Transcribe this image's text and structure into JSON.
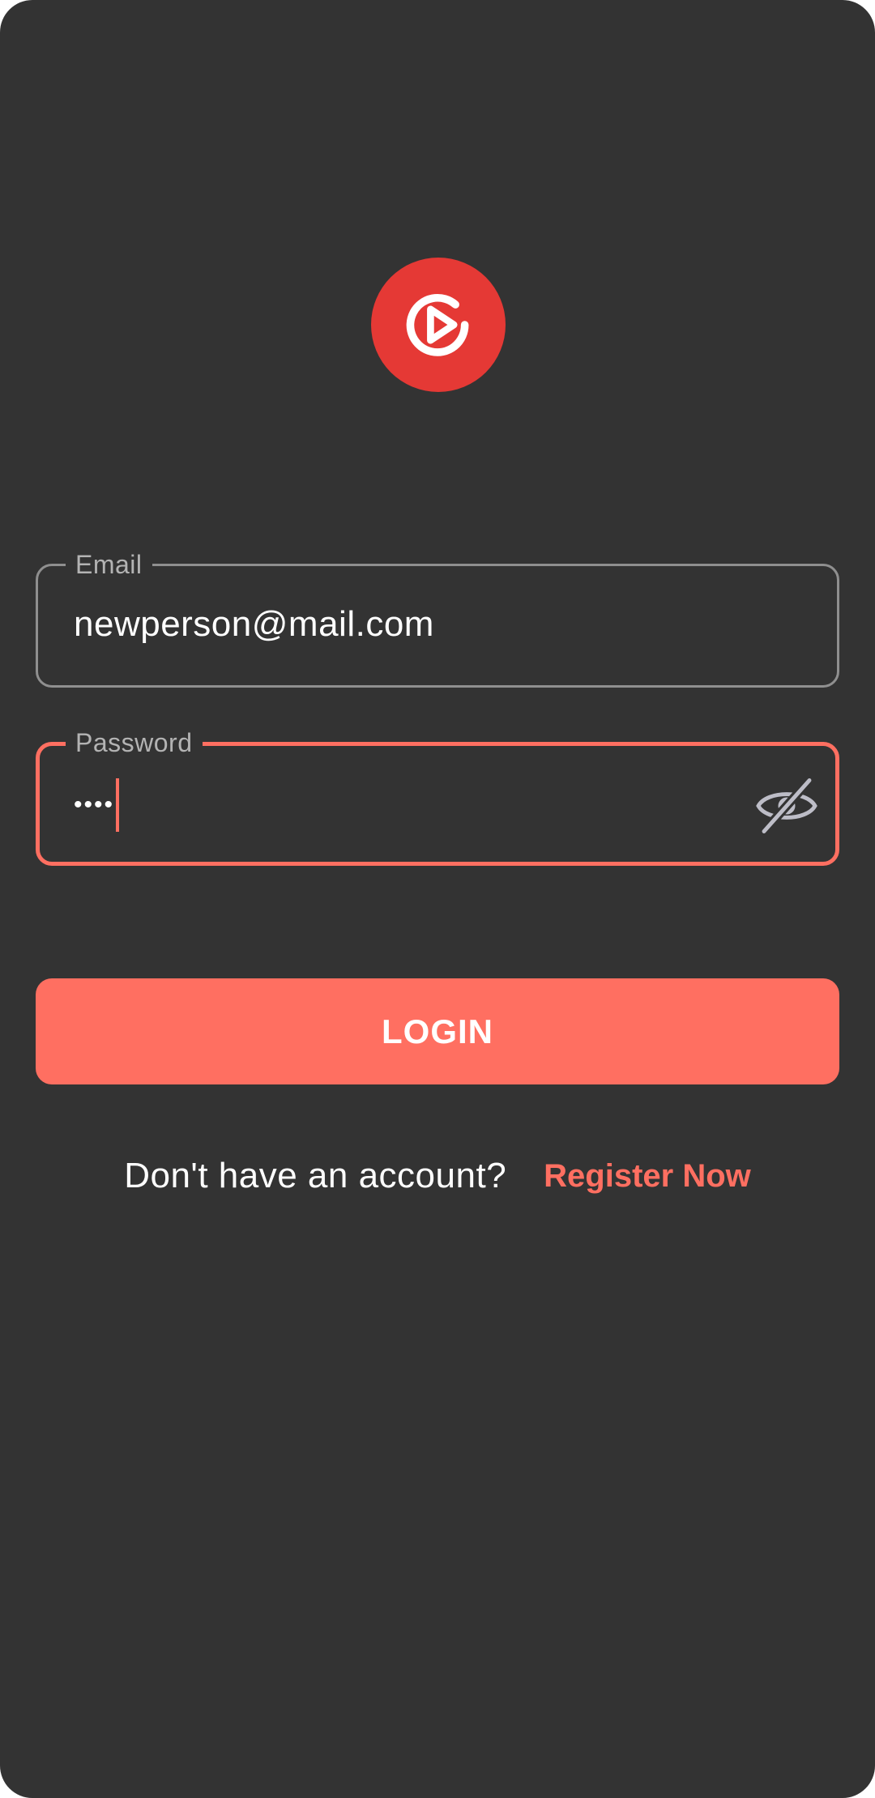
{
  "logo": {
    "icon": "play-circle-icon",
    "background_color": "#e53935"
  },
  "form": {
    "email": {
      "label": "Email",
      "value": "newperson@mail.com"
    },
    "password": {
      "label": "Password",
      "masked_value": "••••",
      "visibility_icon": "visibility-off-icon"
    }
  },
  "login_button": {
    "label": "LOGIN"
  },
  "register": {
    "prompt": "Don't have an account?",
    "link_label": "Register Now"
  },
  "colors": {
    "background": "#333333",
    "accent": "#ff6f61",
    "field_border": "#8f8f8f"
  }
}
